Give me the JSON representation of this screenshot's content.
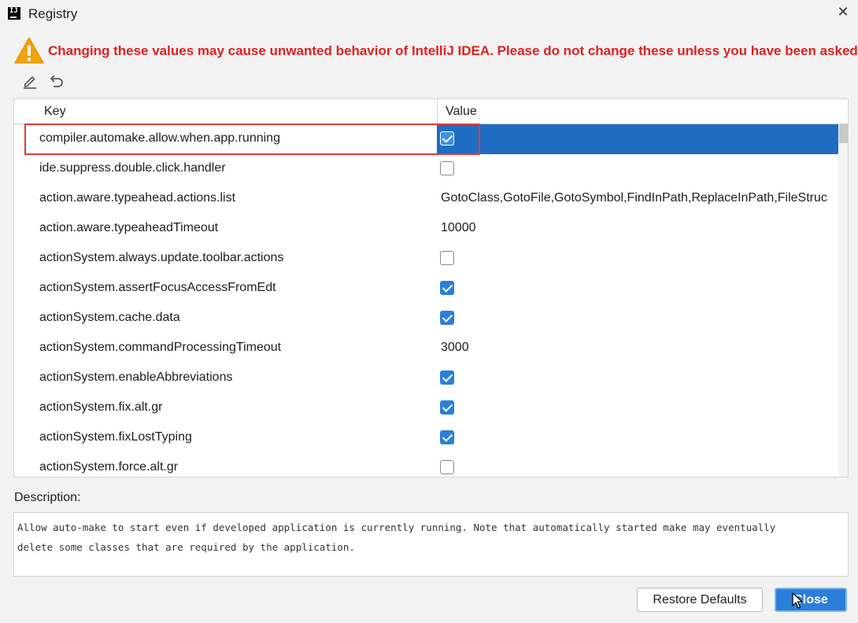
{
  "window": {
    "title": "Registry",
    "close_glyph": "✕"
  },
  "warning": {
    "text": "Changing these values may cause unwanted behavior of IntelliJ IDEA. Please do not change these unless you have been asked."
  },
  "toolbar": {
    "edit_icon": "pencil-icon",
    "revert_icon": "undo-icon"
  },
  "table": {
    "columns": {
      "key": "Key",
      "value": "Value"
    },
    "rows": [
      {
        "key": "compiler.automake.allow.when.app.running",
        "value": "",
        "checkbox": true,
        "selected": true
      },
      {
        "key": "ide.suppress.double.click.handler",
        "value": "",
        "checkbox": false
      },
      {
        "key": "action.aware.typeahead.actions.list",
        "value": "GotoClass,GotoFile,GotoSymbol,FindInPath,ReplaceInPath,FileStruc"
      },
      {
        "key": "action.aware.typeaheadTimeout",
        "value": "10000"
      },
      {
        "key": "actionSystem.always.update.toolbar.actions",
        "value": "",
        "checkbox": false
      },
      {
        "key": "actionSystem.assertFocusAccessFromEdt",
        "value": "",
        "checkbox": true
      },
      {
        "key": "actionSystem.cache.data",
        "value": "",
        "checkbox": true
      },
      {
        "key": "actionSystem.commandProcessingTimeout",
        "value": "3000"
      },
      {
        "key": "actionSystem.enableAbbreviations",
        "value": "",
        "checkbox": true
      },
      {
        "key": "actionSystem.fix.alt.gr",
        "value": "",
        "checkbox": true
      },
      {
        "key": "actionSystem.fixLostTyping",
        "value": "",
        "checkbox": true
      },
      {
        "key": "actionSystem.force.alt.gr",
        "value": "",
        "checkbox": false
      }
    ]
  },
  "description": {
    "label": "Description:",
    "line1": "Allow auto-make to start even if developed application is currently running. Note that automatically started make may eventually",
    "line2": "delete some classes that are required by the application."
  },
  "buttons": {
    "restore": "Restore Defaults",
    "close": "Close"
  },
  "colors": {
    "warning": "#e02020",
    "selection": "#1f6dc2",
    "accent": "#2b7fd8",
    "highlight_box": "#e53935"
  }
}
